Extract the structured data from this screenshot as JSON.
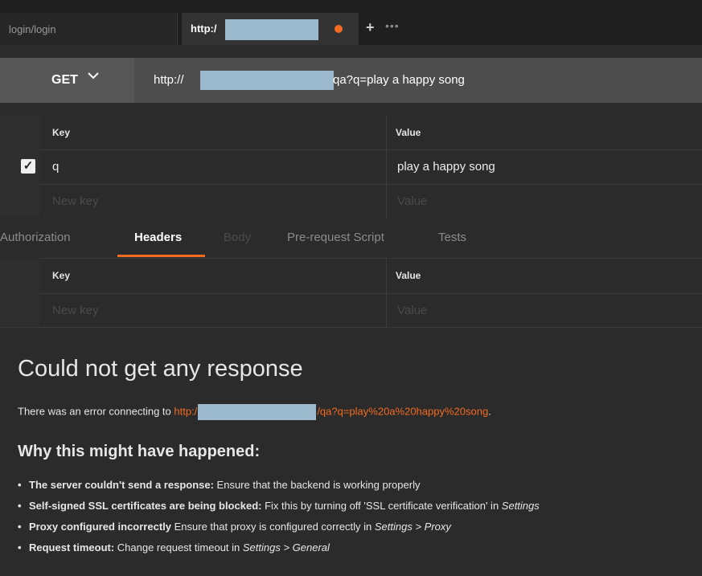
{
  "tabs": [
    {
      "label": "login/login"
    },
    {
      "label": "http:/"
    }
  ],
  "tab_actions": {
    "add": "+",
    "more": "•••"
  },
  "request": {
    "method": "GET",
    "url_prefix": "http://",
    "url_suffix": "qa?q=play a happy song"
  },
  "params": {
    "columns": {
      "key": "Key",
      "value": "Value"
    },
    "rows": [
      {
        "key": "q",
        "value": "play a happy song",
        "checked": true
      }
    ],
    "new_key_placeholder": "New key",
    "new_value_placeholder": "Value"
  },
  "subtabs": [
    {
      "label": "Authorization"
    },
    {
      "label": "Headers",
      "active": true
    },
    {
      "label": "Body",
      "disabled": true
    },
    {
      "label": "Pre-request Script"
    },
    {
      "label": "Tests"
    }
  ],
  "headers_table": {
    "columns": {
      "key": "Key",
      "value": "Value"
    },
    "new_key_placeholder": "New key",
    "new_value_placeholder": "Value"
  },
  "response": {
    "title": "Could not get any response",
    "error_prefix": "There was an error connecting to ",
    "error_link_prefix": "http:/",
    "error_link_suffix": "/qa?q=play%20a%20happy%20song",
    "error_end": ".",
    "why_title": "Why this might have happened:",
    "reasons": [
      {
        "bold": "The server couldn't send a response:",
        "text": " Ensure that the backend is working properly",
        "italic": ""
      },
      {
        "bold": "Self-signed SSL certificates are being blocked:",
        "text": " Fix this by turning off 'SSL certificate verification' in ",
        "italic": "Settings"
      },
      {
        "bold": "Proxy configured incorrectly",
        "text": " Ensure that proxy is configured correctly in ",
        "italic": "Settings > Proxy"
      },
      {
        "bold": "Request timeout:",
        "text": " Change request timeout in ",
        "italic": "Settings > General"
      }
    ]
  },
  "colors": {
    "accent": "#f26b21",
    "redaction": "#9ab9cc"
  }
}
